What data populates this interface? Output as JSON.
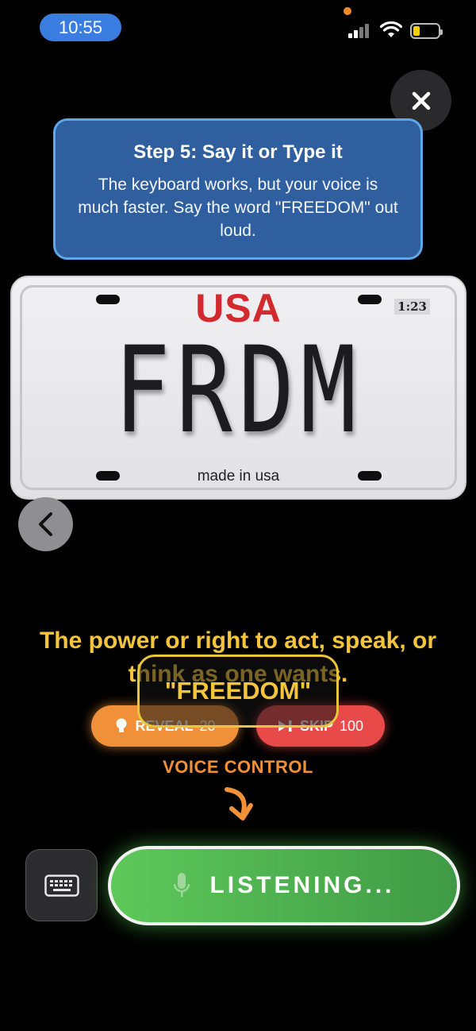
{
  "status_bar": {
    "time": "10:55"
  },
  "tutorial": {
    "title": "Step 5: Say it or Type it",
    "body": "The keyboard works, but your voice is much faster. Say the word \"FREEDOM\" out loud."
  },
  "plate": {
    "country": "USA",
    "timer": "1:23",
    "text": "FRDM",
    "footer": "made in usa"
  },
  "definition": "The power or right to act, speak, or think as one wants.",
  "answer": "\"FREEDOM\"",
  "buttons": {
    "reveal_label": "REVEAL",
    "reveal_count": "20",
    "skip_label": "SKIP",
    "skip_count": "100",
    "listening_label": "LISTENING..."
  },
  "voice_control_label": "VOICE CONTROL",
  "colors": {
    "accent_yellow": "#f4c53a",
    "reveal_orange": "#f0913a",
    "skip_red": "#e84a4a",
    "listen_green": "#4faf4f",
    "card_blue": "#2f5f9f"
  },
  "icons": [
    "close-icon",
    "chevron-left-icon",
    "lightbulb-icon",
    "skip-icon",
    "keyboard-icon",
    "microphone-icon",
    "curved-arrow-down-icon"
  ]
}
